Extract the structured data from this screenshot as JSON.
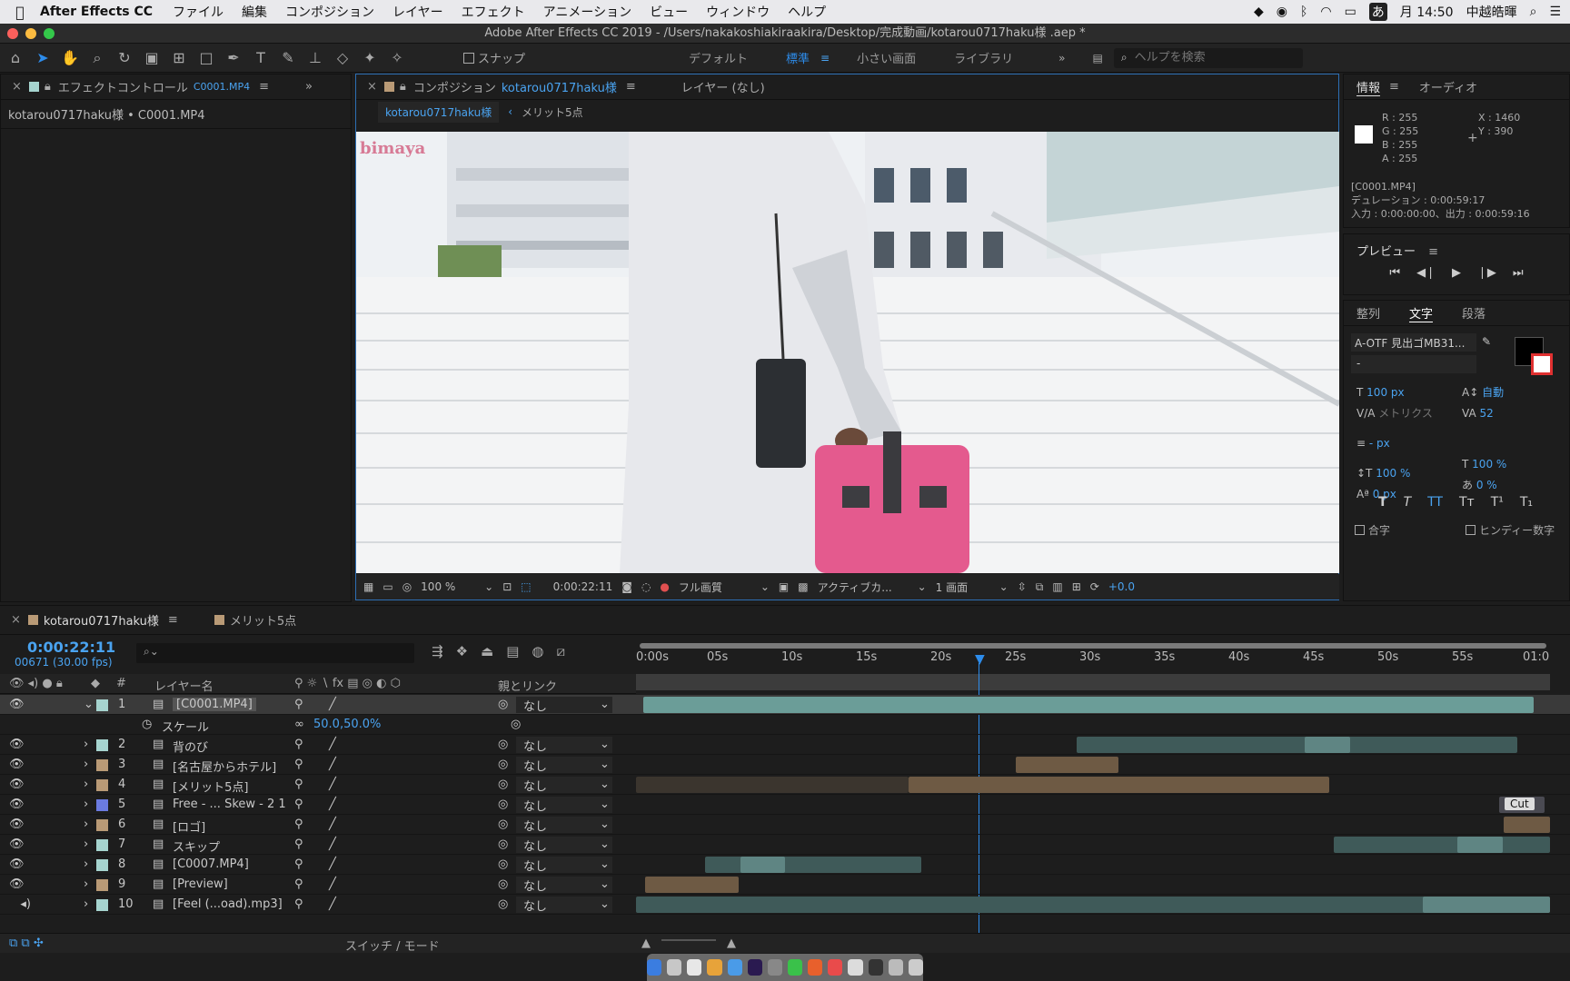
{
  "menubar": {
    "app_name": "After Effects CC",
    "items": [
      "ファイル",
      "編集",
      "コンポジション",
      "レイヤー",
      "エフェクト",
      "アニメーション",
      "ビュー",
      "ウィンドウ",
      "ヘルプ"
    ],
    "clock": "月 14:50",
    "user": "中越皓暉",
    "input_mode": "あ"
  },
  "window_title": "Adobe After Effects CC 2019 - /Users/nakakoshiakiraakira/Desktop/完成動画/kotarou0717haku様 .aep *",
  "toolbar": {
    "snap_label": "スナップ",
    "workspaces": [
      "デフォルト",
      "標準",
      "小さい画面",
      "ライブラリ"
    ],
    "active_workspace": "標準",
    "help_placeholder": "ヘルプを検索"
  },
  "effects_panel": {
    "tab": "エフェクトコントロール",
    "tab_file": "C0001.MP4",
    "breadcrumb": "kotarou0717haku様 • C0001.MP4"
  },
  "comp_panel": {
    "tab": "コンポジション",
    "tab_comp": "kotarou0717haku様",
    "layer_tab": "レイヤー (なし)",
    "sub_tabs": [
      "kotarou0717haku様",
      "メリット5点"
    ],
    "zoom": "100 %",
    "timecode": "0:00:22:11",
    "quality": "フル画質",
    "camera": "アクティブカ...",
    "views": "1 画面",
    "exposure": "+0.0",
    "overlay_text": "bimaya"
  },
  "info_panel": {
    "tab": "情報",
    "tab2": "オーディオ",
    "r": "R : 255",
    "g": "G : 255",
    "b": "B : 255",
    "a": "A : 255",
    "x": "X : 1460",
    "y": "Y : 390",
    "file": "[C0001.MP4]",
    "duration": "デュレーション : 0:00:59:17",
    "inout": "入力 : 0:00:00:00、出力 : 0:00:59:16"
  },
  "preview_panel": {
    "tab": "プレビュー"
  },
  "char_panel": {
    "tabs": [
      "整列",
      "文字",
      "段落"
    ],
    "active_tab": "文字",
    "font": "A-OTF 見出ゴMB31...",
    "style": "-",
    "size": "100 px",
    "leading": "自動",
    "kerning": "メトリクス",
    "tracking": "52",
    "stroke": "- px",
    "vscale": "100 %",
    "hscale": "100 %",
    "baseline": "0 px",
    "tsume": "0 %",
    "ligature": "合字",
    "hindi": "ヒンディー数字"
  },
  "timeline": {
    "tab": "kotarou0717haku様",
    "tab2": "メリット5点",
    "timecode": "0:00:22:11",
    "frames": "00671 (30.00 fps)",
    "col_layer": "レイヤー名",
    "col_parent": "親とリンク",
    "col_num": "#",
    "footer": "スイッチ / モード",
    "scale_prop": "スケール",
    "scale_value": "50.0,50.0%",
    "ruler": [
      "0:00s",
      "05s",
      "10s",
      "15s",
      "20s",
      "25s",
      "30s",
      "35s",
      "40s",
      "45s",
      "50s",
      "55s",
      "01:0"
    ],
    "cut_label": "Cut",
    "layers": [
      {
        "num": "1",
        "name": "[C0001.MP4]",
        "parent": "なし",
        "color": "#a6d4cf"
      },
      {
        "num": "2",
        "name": "背のび",
        "parent": "なし",
        "color": "#a6d4cf"
      },
      {
        "num": "3",
        "name": "[名古屋からホテル]",
        "parent": "なし",
        "color": "#b99a76"
      },
      {
        "num": "4",
        "name": "[メリット5点]",
        "parent": "なし",
        "color": "#b99a76"
      },
      {
        "num": "5",
        "name": "Free - ... Skew - 2 1",
        "parent": "なし",
        "color": "#6b7be0"
      },
      {
        "num": "6",
        "name": "[ロゴ]",
        "parent": "なし",
        "color": "#b99a76"
      },
      {
        "num": "7",
        "name": "スキップ",
        "parent": "なし",
        "color": "#a6d4cf"
      },
      {
        "num": "8",
        "name": "[C0007.MP4]",
        "parent": "なし",
        "color": "#a6d4cf"
      },
      {
        "num": "9",
        "name": "[Preview]",
        "parent": "なし",
        "color": "#b99a76"
      },
      {
        "num": "10",
        "name": "[Feel (...oad).mp3]",
        "parent": "なし",
        "color": "#a6d4cf"
      }
    ]
  }
}
